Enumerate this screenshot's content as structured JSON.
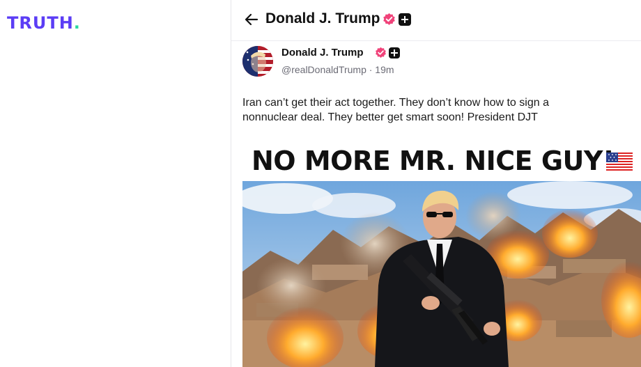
{
  "app": {
    "logo_main": "TRUTH",
    "logo_dot": "."
  },
  "topbar": {
    "title": "Donald J. Trump",
    "back_icon": "arrow-left-icon"
  },
  "post": {
    "author_name": "Donald J. Trump",
    "handle": "@realDonaldTrump · 19m",
    "text": "Iran can’t get their act together. They don’t know how to sign a nonnuclear deal. They better get smart soon! President DJT",
    "media": {
      "headline": "NO MORE MR. NICE GUY!",
      "flag": "us-flag-emoji"
    }
  },
  "colors": {
    "brand": "#5b3df5",
    "brand_accent": "#2ad8a0",
    "verified": "#f0437a"
  }
}
